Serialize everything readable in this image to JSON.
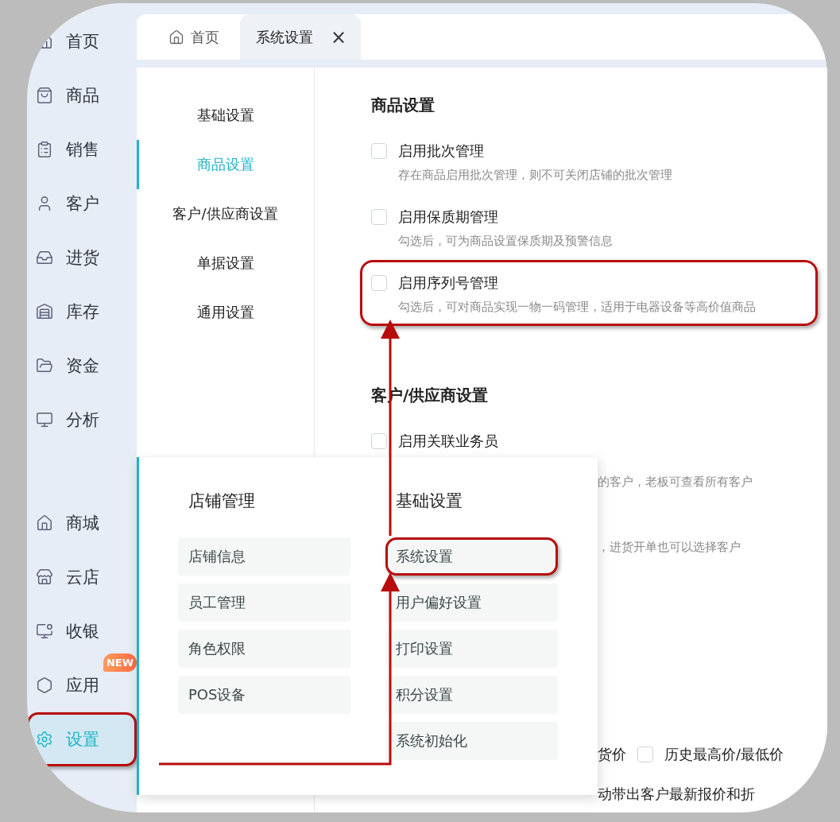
{
  "sidebar": {
    "top_items": [
      {
        "label": "首页",
        "selected": false
      },
      {
        "label": "商品",
        "selected": false
      },
      {
        "label": "销售",
        "selected": false
      },
      {
        "label": "客户",
        "selected": false
      },
      {
        "label": "进货",
        "selected": false
      },
      {
        "label": "库存",
        "selected": false
      },
      {
        "label": "资金",
        "selected": false
      },
      {
        "label": "分析",
        "selected": false
      }
    ],
    "bottom_items": [
      {
        "label": "商城",
        "selected": false,
        "highlighted": false
      },
      {
        "label": "云店",
        "selected": false,
        "highlighted": false
      },
      {
        "label": "收银",
        "selected": false,
        "highlighted": false
      },
      {
        "label": "应用",
        "selected": false,
        "highlighted": false,
        "badge": "NEW"
      },
      {
        "label": "设置",
        "selected": true,
        "highlighted": true
      }
    ]
  },
  "tabs": [
    {
      "label": "首页",
      "selected": false,
      "pinned": true,
      "closable": false
    },
    {
      "label": "系统设置",
      "selected": true,
      "pinned": false,
      "closable": true,
      "close": "×"
    }
  ],
  "settings_nav": [
    {
      "label": "基础设置",
      "selected": false
    },
    {
      "label": "商品设置",
      "selected": true
    },
    {
      "label": "客户/供应商设置",
      "selected": false
    },
    {
      "label": "单据设置",
      "selected": false
    },
    {
      "label": "通用设置",
      "selected": false
    }
  ],
  "goods_section": {
    "title": "商品设置",
    "options": [
      {
        "label": "启用批次管理",
        "checked": false,
        "highlighted": false,
        "description": "存在商品启用批次管理，则不可关闭店铺的批次管理"
      },
      {
        "label": "启用保质期管理",
        "checked": false,
        "highlighted": false,
        "description": "勾选后，可为商品设置保质期及预警信息"
      },
      {
        "label": "启用序列号管理",
        "checked": false,
        "highlighted": true,
        "description": "勾选后，可对商品实现一物一码管理，适用于电器设备等高价值商品"
      }
    ]
  },
  "customer_section": {
    "title": "客户/供应商设置",
    "options": [
      {
        "label": "启用关联业务员",
        "checked": false
      }
    ],
    "covered_rows": [
      {
        "kind": "note",
        "text": "的客户，老板可查看所有客户"
      },
      {
        "kind": "note",
        "text": "，进货开单也可以选择客户"
      },
      {
        "kind": "pair",
        "text": "货价",
        "option": {
          "label": "历史最高价/最低价",
          "checked": false
        }
      },
      {
        "kind": "tail",
        "text": "动带出客户最新报价和折"
      }
    ]
  },
  "popup": {
    "columns": [
      {
        "title": "店铺管理",
        "items": [
          {
            "label": "店铺信息",
            "highlighted": false
          },
          {
            "label": "员工管理",
            "highlighted": false
          },
          {
            "label": "角色权限",
            "highlighted": false
          },
          {
            "label": "POS设备",
            "highlighted": false
          }
        ]
      },
      {
        "title": "基础设置",
        "items": [
          {
            "label": "系统设置",
            "highlighted": true
          },
          {
            "label": "用户偏好设置",
            "highlighted": false
          },
          {
            "label": "打印设置",
            "highlighted": false
          },
          {
            "label": "积分设置",
            "highlighted": false
          },
          {
            "label": "系统初始化",
            "highlighted": false
          }
        ]
      }
    ]
  }
}
